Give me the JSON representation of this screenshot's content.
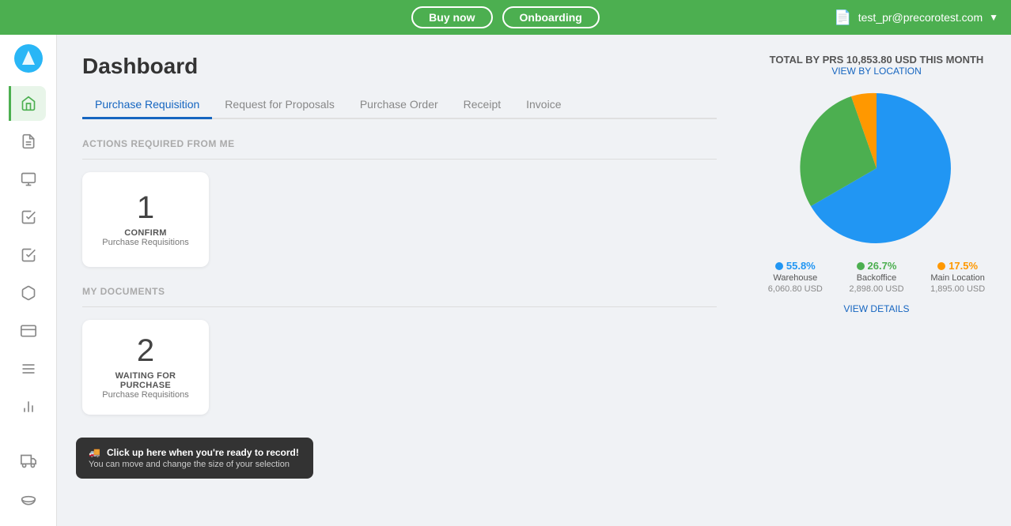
{
  "topbar": {
    "buy_now_label": "Buy now",
    "onboarding_label": "Onboarding",
    "user_email": "test_pr@precorotest.com"
  },
  "sidebar": {
    "items": [
      {
        "id": "home",
        "icon": "⌂",
        "active": true
      },
      {
        "id": "list",
        "icon": "☰"
      },
      {
        "id": "invoice",
        "icon": "▤"
      },
      {
        "id": "document",
        "icon": "▦"
      },
      {
        "id": "cart",
        "icon": "🛒"
      },
      {
        "id": "check-circle",
        "icon": "✓"
      },
      {
        "id": "box",
        "icon": "⬡"
      },
      {
        "id": "card",
        "icon": "▬"
      },
      {
        "id": "menu",
        "icon": "≡"
      },
      {
        "id": "chart",
        "icon": "▲"
      }
    ]
  },
  "page": {
    "title": "Dashboard"
  },
  "tabs": [
    {
      "id": "purchase-requisition",
      "label": "Purchase Requisition",
      "active": true
    },
    {
      "id": "request-for-proposals",
      "label": "Request for Proposals",
      "active": false
    },
    {
      "id": "purchase-order",
      "label": "Purchase Order",
      "active": false
    },
    {
      "id": "receipt",
      "label": "Receipt",
      "active": false
    },
    {
      "id": "invoice",
      "label": "Invoice",
      "active": false
    }
  ],
  "actions_section": {
    "label": "ACTIONS REQUIRED FROM ME",
    "cards": [
      {
        "number": "1",
        "action": "CONFIRM",
        "type": "Purchase Requisitions"
      }
    ]
  },
  "my_documents_section": {
    "label": "MY DOCUMENTS",
    "cards": [
      {
        "number": "2",
        "action": "WAITING FOR PURCHASE",
        "type": "Purchase Requisitions"
      }
    ]
  },
  "chart": {
    "total_label": "TOTAL BY PRS 10,853.80 USD THIS MONTH",
    "view_by_location_label": "VIEW BY LOCATION",
    "view_details_label": "VIEW DETAILS",
    "segments": [
      {
        "label": "Warehouse",
        "pct": 55.8,
        "color": "#2196f3",
        "amount": "6,060.80 USD",
        "pct_label": "55.8%"
      },
      {
        "label": "Backoffice",
        "pct": 26.7,
        "color": "#4caf50",
        "amount": "2,898.00 USD",
        "pct_label": "26.7%"
      },
      {
        "label": "Main Location",
        "pct": 17.5,
        "color": "#ff9800",
        "amount": "1,895.00 USD",
        "pct_label": "17.5%"
      }
    ]
  },
  "onboarding_tooltip": {
    "icon": "🚀",
    "title": "Click up here when you're ready to record!",
    "subtitle": "You can move and change the size of your selection"
  }
}
